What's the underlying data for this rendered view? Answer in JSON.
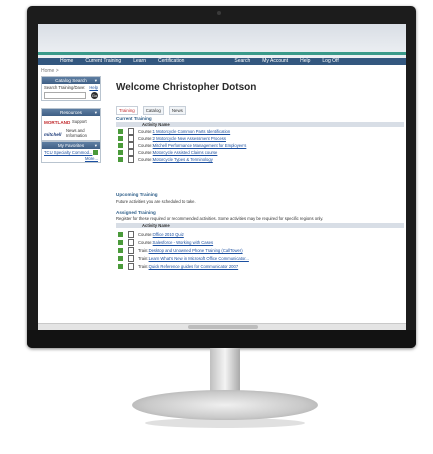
{
  "nav": {
    "items_left": [
      "Home",
      "Current Training",
      "Learn",
      "Certification"
    ],
    "items_right": [
      "Search",
      "My Account",
      "Help",
      "Log Off"
    ]
  },
  "breadcrumb": "Home >",
  "sidebar": {
    "catalog_search": {
      "title": "Catalog Search",
      "label": "Search Training/Dave:",
      "link": "Help",
      "go": "Go"
    },
    "resources": {
      "title": "Resources",
      "items": [
        {
          "logo": "MORTLAND",
          "label": "Support"
        },
        {
          "logo": "mitchell",
          "label": "News and Information"
        }
      ]
    },
    "favorites": {
      "title": "My Favorites",
      "item": "TCU Specialty Commod...",
      "more": "More..."
    }
  },
  "main": {
    "welcome": "Welcome Christopher Dotson",
    "tabs": [
      "Training",
      "Catalog",
      "News"
    ],
    "current_training": {
      "title": "Current Training",
      "column": "Activity Name",
      "rows": [
        {
          "type": "Course:",
          "name": "1 Motorcycle Common Parts Identification"
        },
        {
          "type": "Course:",
          "name": "2 Motorcycle New Assessment Process"
        },
        {
          "type": "Course:",
          "name": "Mitchell Performance Management for Employee's"
        },
        {
          "type": "Course:",
          "name": "Motorcycle Assisted Claims course"
        },
        {
          "type": "Course:",
          "name": "Motorcycle Types & Terminology"
        }
      ]
    },
    "upcoming": {
      "title": "Upcoming Training",
      "note": "Future activities you are scheduled to take."
    },
    "assigned": {
      "title": "Assigned Training",
      "note": "Register for these required or recommended activities. Some activities may be required for specific regions only.",
      "column": "Activity Name",
      "rows": [
        {
          "type": "Course:",
          "name": "Office 2010 Quiz"
        },
        {
          "type": "Course:",
          "name": "Salesforce - Working with Cases"
        },
        {
          "type": "Train:",
          "name": "Desktop and Unowned Phone Training (CallTower)"
        },
        {
          "type": "Train:",
          "name": "Learn What's New in Microsoft Office Communicator..."
        },
        {
          "type": "Train:",
          "name": "Quick Reference guides for Communicator 2007"
        }
      ]
    }
  }
}
